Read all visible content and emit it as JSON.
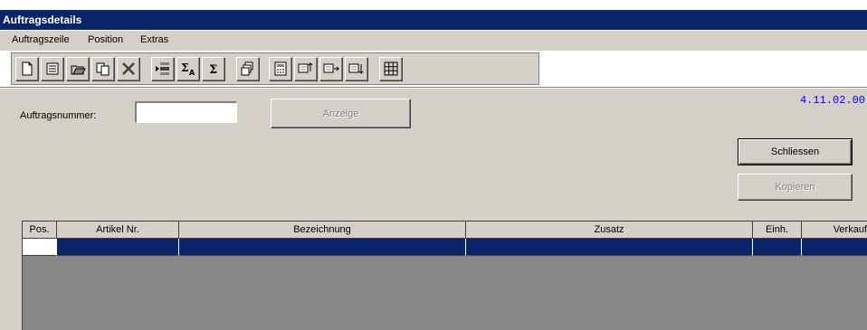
{
  "window": {
    "title": "Auftragsdetails"
  },
  "menu": {
    "items": [
      {
        "label": "Auftragszeile",
        "underline": "A"
      },
      {
        "label": "Position",
        "underline": "P"
      },
      {
        "label": "Extras",
        "underline": "x"
      }
    ]
  },
  "toolbar": {
    "buttons": [
      {
        "icon": "new-document-icon"
      },
      {
        "icon": "form-icon"
      },
      {
        "icon": "open-folder-icon"
      },
      {
        "icon": "copy-icon"
      },
      {
        "icon": "delete-icon"
      },
      {
        "icon": "insert-row-icon"
      },
      {
        "icon": "sum-a-icon"
      },
      {
        "icon": "sum-icon"
      },
      {
        "icon": "print-preview-icon"
      },
      {
        "icon": "calculator-icon"
      },
      {
        "icon": "move-up-icon"
      },
      {
        "icon": "move-right-icon"
      },
      {
        "icon": "move-down-icon"
      },
      {
        "icon": "grid-icon"
      }
    ]
  },
  "version": "4.11.02.00",
  "form": {
    "order_number_label": "Auftragsnummer:",
    "order_number_value": "",
    "show_button": "Anzeige",
    "close_button": "Schliessen",
    "copy_button": "Kopieren"
  },
  "table": {
    "columns": [
      "Pos.",
      "Artikel Nr.",
      "Bezeichnung",
      "Zusatz",
      "Einh.",
      "Verkauf"
    ],
    "rows": [
      [
        "",
        "",
        "",
        "",
        "",
        ""
      ]
    ]
  },
  "colors": {
    "title_bar": "#0a246a",
    "selected_row": "#0a246a",
    "version_text": "#0000ff",
    "grid_empty": "#878787",
    "window_bg": "#d4d0c8"
  }
}
